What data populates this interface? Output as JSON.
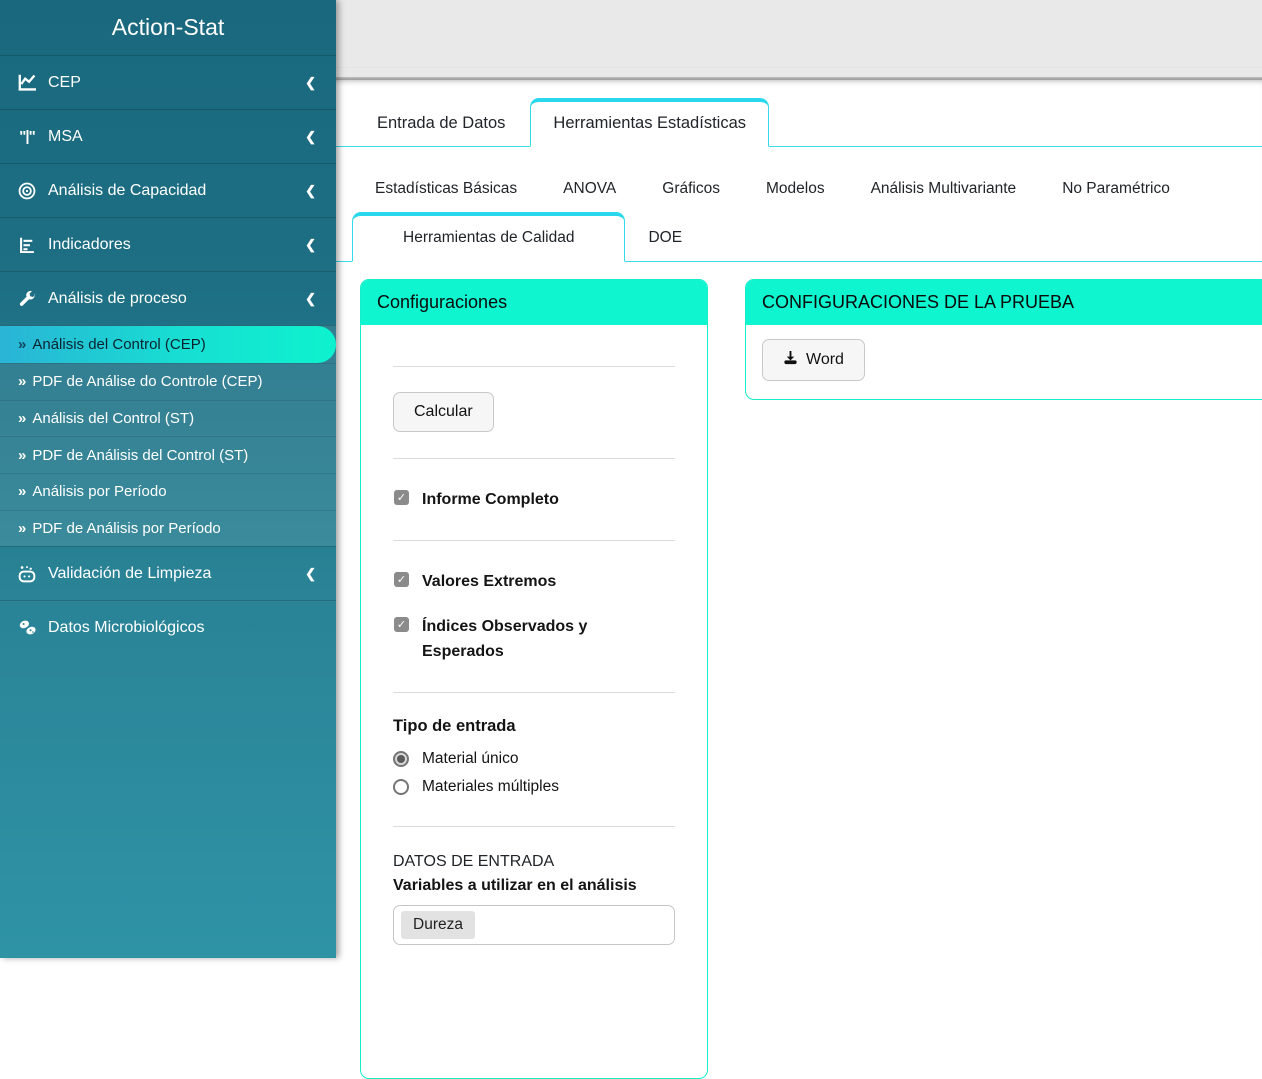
{
  "app": {
    "title": "Action-Stat"
  },
  "colors": {
    "sidebar_teal_top": "#19687e",
    "sidebar_teal_bottom": "#2f93a6",
    "active_item_gradient_left": "#2ab4d6",
    "active_item_gradient_right": "#0df2ce",
    "panel_header_turquoise": "#0ef5d0",
    "tab_border_cyan": "#36d9ec",
    "panel_border_cyan": "#16eec9"
  },
  "sidebar": {
    "items": [
      {
        "label": "CEP",
        "icon": "chart-line-icon",
        "chevron": "collapsed"
      },
      {
        "label": "MSA",
        "icon": "antenna-icon",
        "chevron": "collapsed"
      },
      {
        "label": "Análisis de Capacidad",
        "icon": "bullseye-icon",
        "chevron": "collapsed"
      },
      {
        "label": "Indicadores",
        "icon": "bar-chart-icon",
        "chevron": "collapsed"
      },
      {
        "label": "Análisis de proceso",
        "icon": "wrench-icon",
        "chevron": "collapsed"
      }
    ],
    "submenu": [
      {
        "label": "Análisis del Control (CEP)",
        "active": true
      },
      {
        "label": "PDF de Análise do Controle (CEP)",
        "active": false
      },
      {
        "label": "Análisis del Control (ST)",
        "active": false
      },
      {
        "label": "PDF de Análisis del Control (ST)",
        "active": false
      },
      {
        "label": "Análisis por Período",
        "active": false
      },
      {
        "label": "PDF de Análisis por Período",
        "active": false
      }
    ],
    "items_bottom": [
      {
        "label": "Validación de Limpieza",
        "icon": "soap-icon",
        "chevron": "collapsed"
      },
      {
        "label": "Datos Microbiológicos",
        "icon": "bacteria-icon"
      }
    ]
  },
  "tabs": {
    "main": [
      {
        "label": "Entrada de Datos",
        "active": false
      },
      {
        "label": "Herramientas Estadísticas",
        "active": true
      }
    ],
    "sub": [
      {
        "label": "Estadísticas Básicas",
        "active": false
      },
      {
        "label": "ANOVA",
        "active": false
      },
      {
        "label": "Gráficos",
        "active": false
      },
      {
        "label": "Modelos",
        "active": false
      },
      {
        "label": "Análisis Multivariante",
        "active": false
      },
      {
        "label": "No Paramétrico",
        "active": false
      },
      {
        "label": "Herramientas de Calidad",
        "active": true
      },
      {
        "label": "DOE",
        "active": false
      }
    ]
  },
  "config_panel": {
    "title": "Configuraciones",
    "calculate_button": "Calcular",
    "checkboxes": [
      {
        "label": "Informe Completo",
        "checked": true
      },
      {
        "label": "Valores Extremos",
        "checked": true
      },
      {
        "label": "Índices Observados y Esperados",
        "checked": true
      }
    ],
    "input_type": {
      "heading": "Tipo de entrada",
      "options": [
        {
          "label": "Material único",
          "selected": true
        },
        {
          "label": "Materiales múltiples",
          "selected": false
        }
      ]
    },
    "data_entry": {
      "section": "DATOS DE ENTRADA",
      "label": "Variables a utilizar en el análisis",
      "selected_variable": "Dureza"
    }
  },
  "test_panel": {
    "title": "CONFIGURACIONES DE LA PRUEBA",
    "word_button": "Word"
  }
}
